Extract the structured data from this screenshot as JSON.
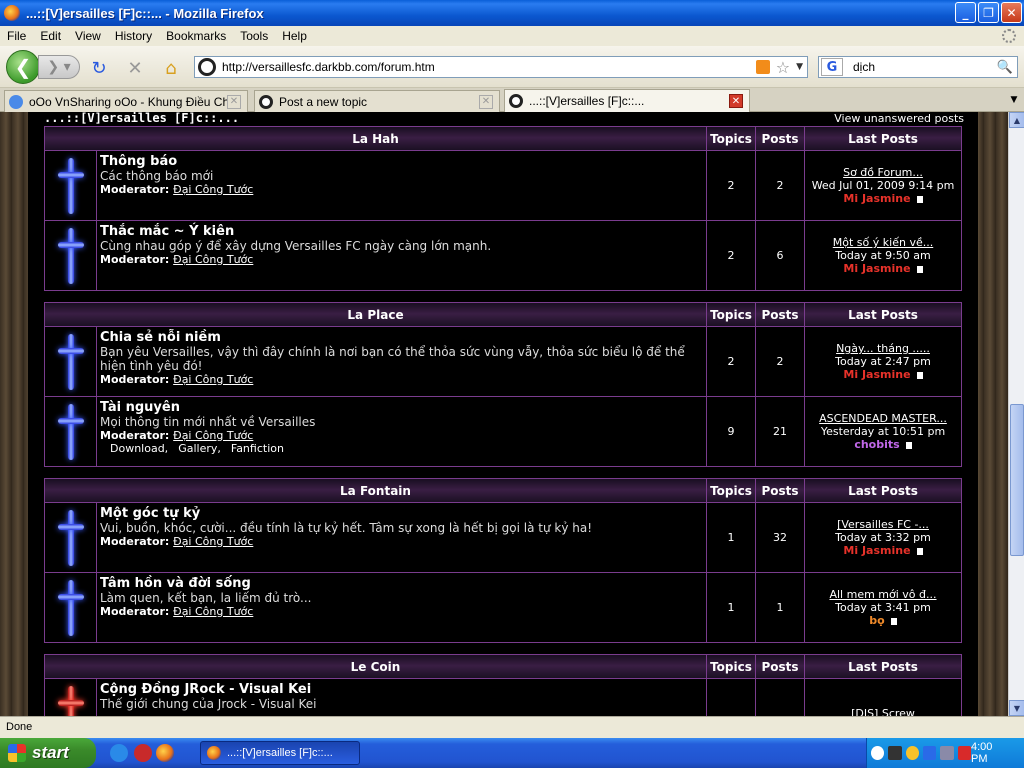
{
  "window": {
    "title": "...::[V]ersailles [F]c::... - Mozilla Firefox",
    "minimize": "_",
    "maximize": "❐",
    "close": "✕"
  },
  "menu": [
    "File",
    "Edit",
    "View",
    "History",
    "Bookmarks",
    "Tools",
    "Help"
  ],
  "nav": {
    "url": "http://versaillesfc.darkbb.com/forum.htm",
    "search_value": "dịch",
    "search_engine": "G"
  },
  "tabs": [
    {
      "label": "oOo VnSharing oOo - Khung Điều Chỉnh",
      "active": false
    },
    {
      "label": "Post a new topic",
      "active": false
    },
    {
      "label": "...::[V]ersailles [F]c::...",
      "active": true
    }
  ],
  "page": {
    "site_title": "...::[V]ersailles [F]c::...",
    "view_unanswered": "View unanswered posts",
    "col_topics": "Topics",
    "col_posts": "Posts",
    "col_last": "Last Posts",
    "moderator_label": "Moderator:",
    "categories": [
      {
        "name": "La Hah",
        "forums": [
          {
            "title": "Thông báo",
            "desc": "Các thông báo mới",
            "moderator": "Đại Công Tước",
            "topics": "2",
            "posts": "2",
            "last_title": "Sơ đồ Forum...",
            "last_date": "Wed Jul 01, 2009 9:14 pm",
            "last_user": "Mi Jasmine",
            "user_color": "red"
          },
          {
            "title": "Thắc mắc ~ Ý kiên",
            "desc": "Cùng nhau góp ý để xây dựng Versailles FC ngày càng lớn mạnh.",
            "moderator": "Đại Công Tước",
            "topics": "2",
            "posts": "6",
            "last_title": "Một số ý kiến về...",
            "last_date": "Today at 9:50 am",
            "last_user": "Mi Jasmine",
            "user_color": "red"
          }
        ]
      },
      {
        "name": "La Place",
        "forums": [
          {
            "title": "Chia sẻ nỗi niềm",
            "desc": "Bạn yêu Versailles, vậy thì đây chính là nơi bạn có thể thỏa sức vùng vẫy, thỏa sức biểu lộ để thể hiện tình yêu đó!",
            "moderator": "Đại Công Tước",
            "topics": "2",
            "posts": "2",
            "last_title": "Ngày... tháng .....",
            "last_date": "Today at 2:47 pm",
            "last_user": "Mi Jasmine",
            "user_color": "red"
          },
          {
            "title": "Tài nguyên",
            "desc": "Mọi thông tin mới nhất về Versailles",
            "moderator": "Đại Công Tước",
            "topics": "9",
            "posts": "21",
            "sublinks": [
              "Download,",
              "Gallery,",
              "Fanfiction"
            ],
            "last_title": "ASCENDEAD MASTER...",
            "last_date": "Yesterday at 10:51 pm",
            "last_user": "chobits",
            "user_color": "purple"
          }
        ]
      },
      {
        "name": "La Fontain",
        "forums": [
          {
            "title": "Một góc tự kỷ",
            "desc": "Vui, buồn, khóc, cười... đều tính là tự kỷ hết. Tâm sự xong là hết bị gọi là tự kỷ ha!",
            "moderator": "Đại Công Tước",
            "topics": "1",
            "posts": "32",
            "last_title": "[Versailles FC -...",
            "last_date": "Today at 3:32 pm",
            "last_user": "Mi Jasmine",
            "user_color": "red"
          },
          {
            "title": "Tâm hồn và đời sống",
            "desc": "Làm quen, kết bạn, la liếm đủ trò...",
            "moderator": "Đại Công Tước",
            "topics": "1",
            "posts": "1",
            "last_title": "All mem mới vô đ...",
            "last_date": "Today at 3:41 pm",
            "last_user": "bọ",
            "user_color": "orange"
          }
        ]
      },
      {
        "name": "Le Coin",
        "forums": [
          {
            "title": "Cộng Đồng JRock - Visual Kei",
            "desc": "Thế giới chung của Jrock - Visual Kei",
            "moderator": "",
            "topics": "",
            "posts": "",
            "last_title": "[DIS] Screw",
            "last_date": "",
            "last_user": "",
            "user_color": "red",
            "icon": "red"
          }
        ]
      }
    ]
  },
  "status": "Done",
  "taskbar": {
    "start": "start",
    "active_window": "...::[V]ersailles [F]c::...",
    "clock": "4:00 PM"
  }
}
